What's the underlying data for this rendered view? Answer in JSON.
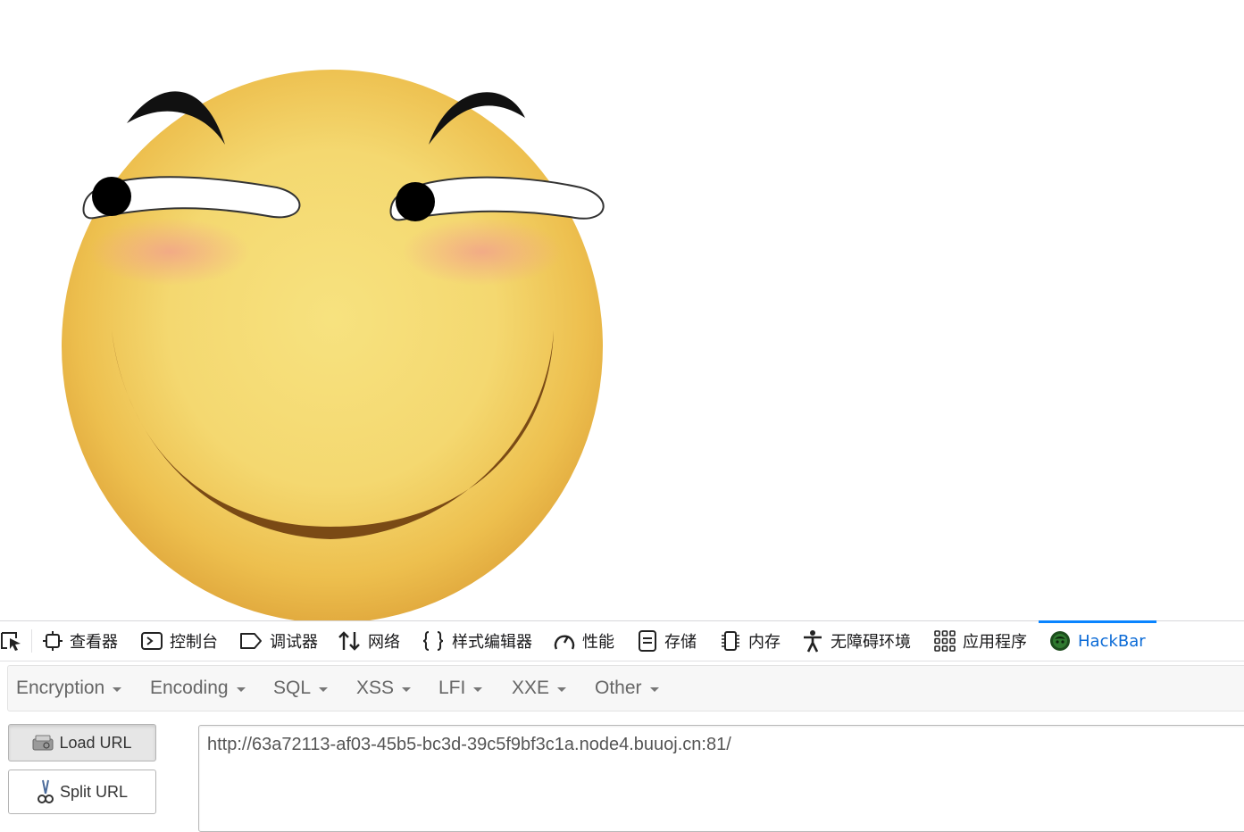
{
  "page": {
    "image_name": "smiling-emoji-image"
  },
  "devtools": {
    "tabs": [
      {
        "label": "查看器",
        "icon": "inspector-icon"
      },
      {
        "label": "控制台",
        "icon": "console-icon"
      },
      {
        "label": "调试器",
        "icon": "debugger-icon"
      },
      {
        "label": "网络",
        "icon": "network-icon"
      },
      {
        "label": "样式编辑器",
        "icon": "style-editor-icon"
      },
      {
        "label": "性能",
        "icon": "performance-icon"
      },
      {
        "label": "存储",
        "icon": "storage-icon"
      },
      {
        "label": "内存",
        "icon": "memory-icon"
      },
      {
        "label": "无障碍环境",
        "icon": "accessibility-icon"
      },
      {
        "label": "应用程序",
        "icon": "application-icon"
      },
      {
        "label": "HackBar",
        "icon": "hackbar-icon",
        "active": true
      }
    ],
    "accent_color": "#0a84ff"
  },
  "hackbar": {
    "menus": [
      "Encryption",
      "Encoding",
      "SQL",
      "XSS",
      "LFI",
      "XXE",
      "Other"
    ],
    "load_url_label": "Load URL",
    "split_url_label": "Split URL",
    "url_value": "http://63a72113-af03-45b5-bc3d-39c5f9bf3c1a.node4.buuoj.cn:81/"
  }
}
